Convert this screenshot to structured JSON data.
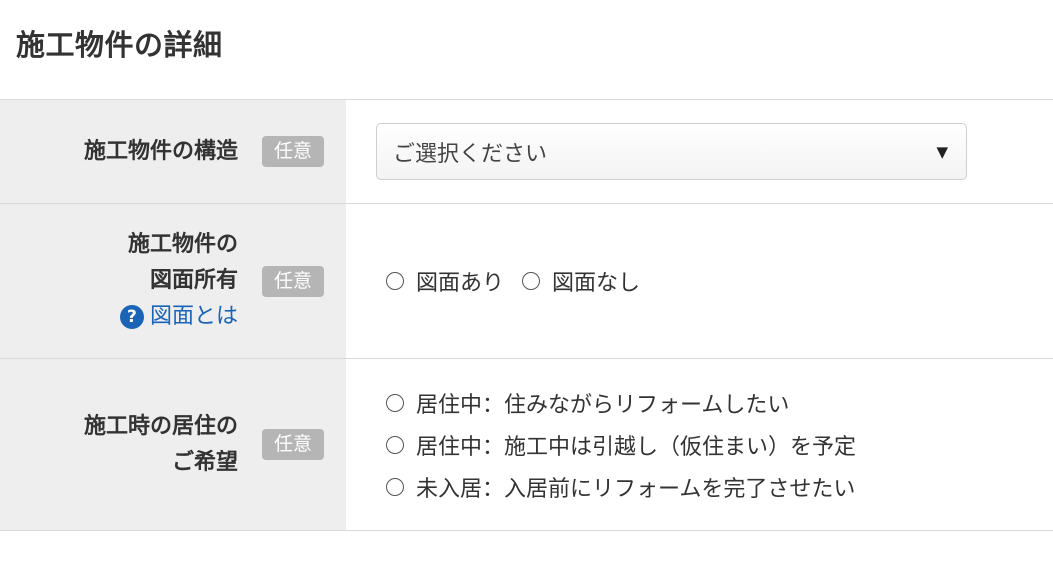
{
  "title": "施工物件の詳細",
  "badge_label": "任意",
  "rows": {
    "structure": {
      "label": "施工物件の構造",
      "select": {
        "selected": "ご選択ください"
      }
    },
    "drawing": {
      "label_line1": "施工物件の",
      "label_line2": "図面所有",
      "help_text": "図面とは",
      "options": [
        "図面あり",
        "図面なし"
      ]
    },
    "residence": {
      "label_line1": "施工時の居住の",
      "label_line2": "ご希望",
      "options": [
        "居住中：住みながらリフォームしたい",
        "居住中：施工中は引越し（仮住まい）を予定",
        "未入居：入居前にリフォームを完了させたい"
      ]
    }
  },
  "colors": {
    "label_bg": "#eeeeee",
    "badge_bg": "#b5b5b5",
    "link": "#1a64b8",
    "border": "#d9d9d9"
  }
}
